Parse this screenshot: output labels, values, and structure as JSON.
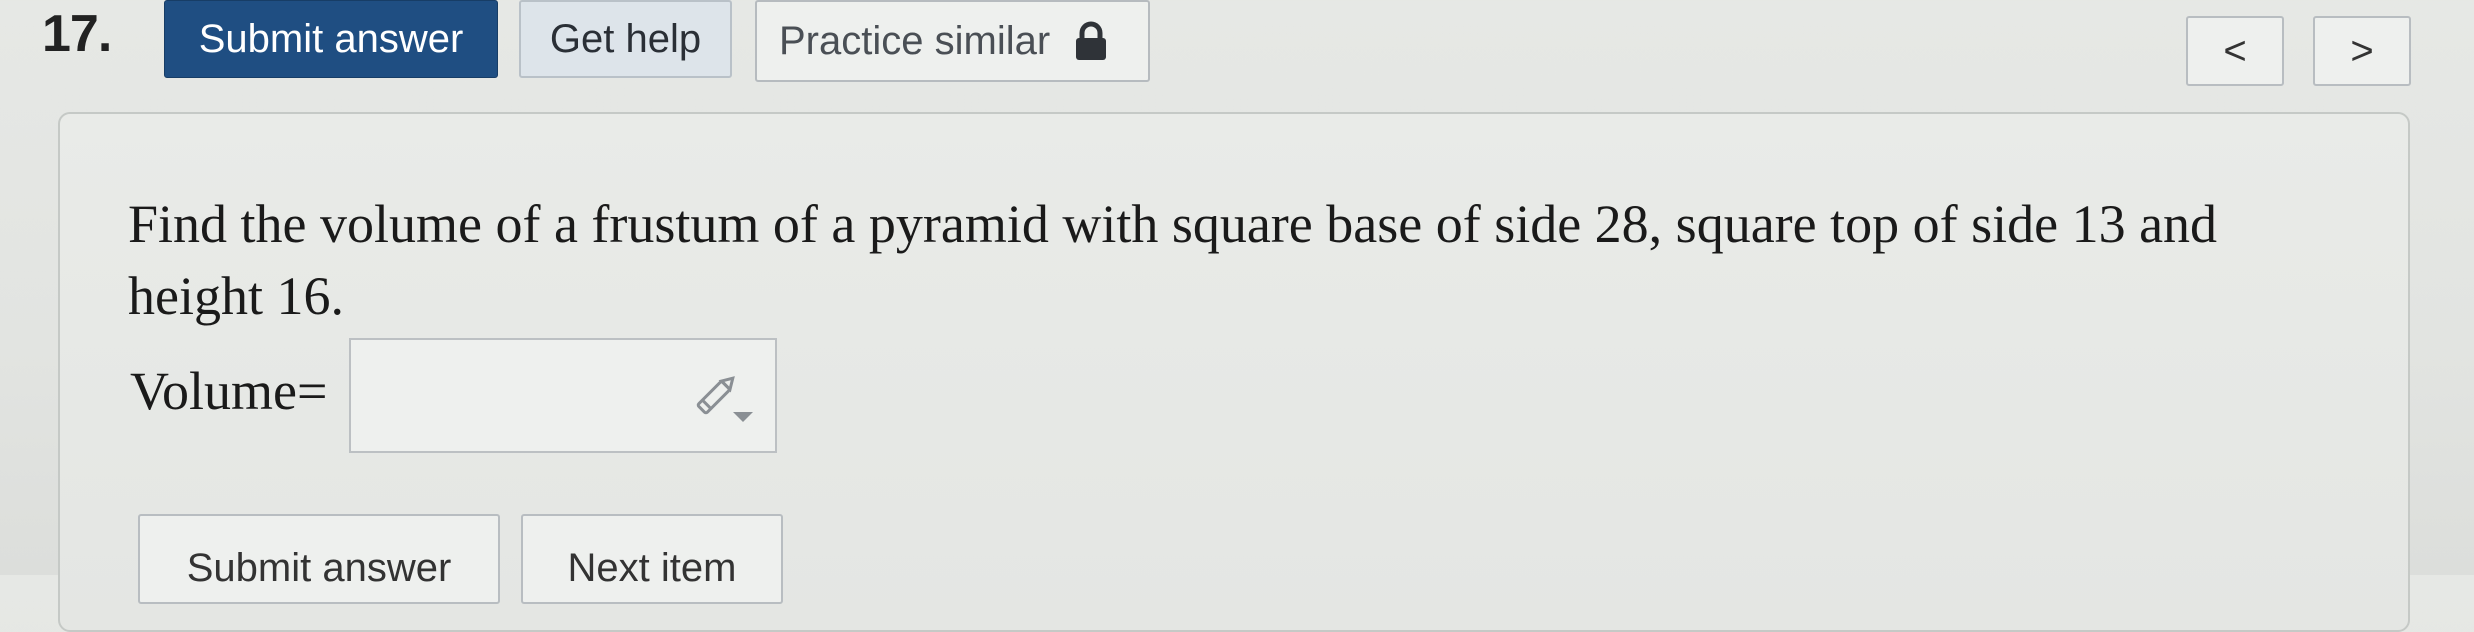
{
  "header": {
    "question_number": "17.",
    "submit_label": "Submit answer",
    "help_label": "Get help",
    "practice_label": "Practice similar",
    "prev_label": "<",
    "next_label": ">"
  },
  "question": {
    "text": "Find the volume of a frustum of a pyramid with square base of side 28, square top of side 13 and height 16.",
    "answer_label": "Volume=",
    "answer_value": ""
  },
  "footer": {
    "submit_label": "Submit answer",
    "next_item_label": "Next item"
  },
  "icons": {
    "practice_lock": "lock-icon",
    "answer_tool": "pencil-dropdown-icon"
  },
  "colors": {
    "primary_button": "#1f4e82",
    "background": "#e4e6e3"
  }
}
